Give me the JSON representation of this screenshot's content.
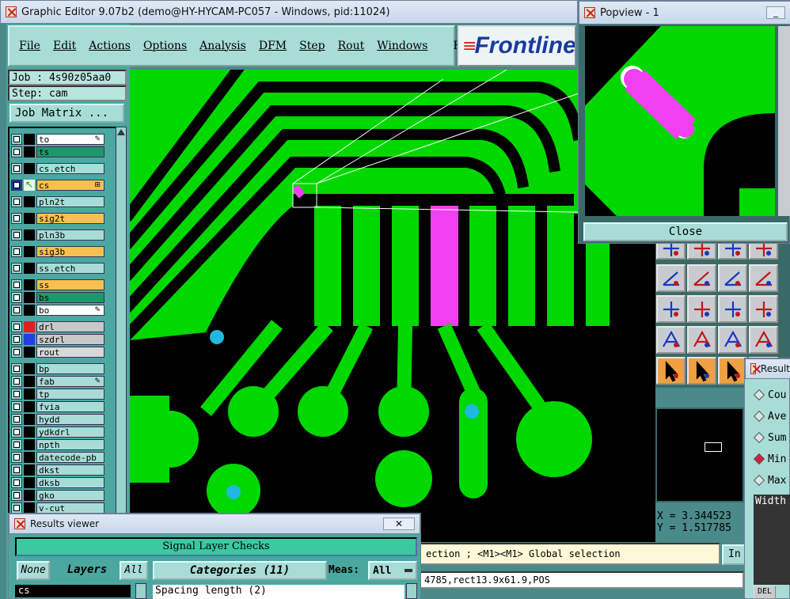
{
  "main_window": {
    "title": "Graphic Editor 9.07b2 (demo@HY-HYCAM-PC057 - Windows, pid:11024)"
  },
  "menu": [
    "File",
    "Edit",
    "Actions",
    "Options",
    "Analysis",
    "DFM",
    "Step",
    "Rout",
    "Windows",
    "Help"
  ],
  "logo_text": "Frontline",
  "job": {
    "label": "Job : 4s90z05aa0",
    "step": "Step: cam",
    "matrix_button": "Job Matrix ..."
  },
  "layers": [
    {
      "name": "to",
      "bg": "#ffffff",
      "swatch": "",
      "mark": "pen"
    },
    {
      "name": "ts",
      "bg": "#1a9a6a",
      "swatch": "",
      "mark": ""
    },
    {
      "name": "cs.etch",
      "bg": "#a8dcd6",
      "swatch": "",
      "mark": ""
    },
    {
      "name": "cs",
      "bg": "#f8c050",
      "swatch": "work",
      "mark": "grid"
    },
    {
      "name": "pln2t",
      "bg": "#a8dcd6",
      "swatch": "",
      "mark": ""
    },
    {
      "name": "sig2t",
      "bg": "#f8c050",
      "swatch": "",
      "mark": ""
    },
    {
      "name": "pln3b",
      "bg": "#a8dcd6",
      "swatch": "",
      "mark": ""
    },
    {
      "name": "sig3b",
      "bg": "#f8c050",
      "swatch": "",
      "mark": ""
    },
    {
      "name": "ss.etch",
      "bg": "#a8dcd6",
      "swatch": "",
      "mark": ""
    },
    {
      "name": "ss",
      "bg": "#f8c050",
      "swatch": "",
      "mark": ""
    },
    {
      "name": "bs",
      "bg": "#1a9a6a",
      "swatch": "",
      "mark": ""
    },
    {
      "name": "bo",
      "bg": "#ffffff",
      "swatch": "",
      "mark": "pen"
    },
    {
      "name": "drl",
      "bg": "#c8c8c8",
      "swatch": "#e02020",
      "mark": ""
    },
    {
      "name": "szdrl",
      "bg": "#c8c8c8",
      "swatch": "#2040e0",
      "mark": ""
    },
    {
      "name": "rout",
      "bg": "#d8d8d8",
      "swatch": "",
      "mark": ""
    },
    {
      "name": "bp",
      "bg": "#a8dcd6",
      "swatch": "",
      "mark": ""
    },
    {
      "name": "fab",
      "bg": "#a8dcd6",
      "swatch": "",
      "mark": "pen"
    },
    {
      "name": "tp",
      "bg": "#a8dcd6",
      "swatch": "",
      "mark": ""
    },
    {
      "name": "fvia",
      "bg": "#a8dcd6",
      "swatch": "",
      "mark": ""
    },
    {
      "name": "hydd",
      "bg": "#a8dcd6",
      "swatch": "",
      "mark": ""
    },
    {
      "name": "ydkdrl",
      "bg": "#a8dcd6",
      "swatch": "",
      "mark": ""
    },
    {
      "name": "npth",
      "bg": "#a8dcd6",
      "swatch": "",
      "mark": ""
    },
    {
      "name": "datecode-pb",
      "bg": "#a8dcd6",
      "swatch": "",
      "mark": ""
    },
    {
      "name": "dkst",
      "bg": "#a8dcd6",
      "swatch": "",
      "mark": ""
    },
    {
      "name": "dksb",
      "bg": "#a8dcd6",
      "swatch": "",
      "mark": ""
    },
    {
      "name": "gko",
      "bg": "#a8dcd6",
      "swatch": "",
      "mark": ""
    },
    {
      "name": "v-cut",
      "bg": "#a8dcd6",
      "swatch": "",
      "mark": ""
    }
  ],
  "popview": {
    "title": "Popview - 1",
    "close": "Close"
  },
  "coords": {
    "x": "X = 3.344523",
    "y": "Y = 1.517785"
  },
  "status": {
    "message": "ection ; <M1><M1> Global selection",
    "info": "4785,rect13.9x61.9,POS",
    "in_btn": "In"
  },
  "results_viewer": {
    "title": "Results viewer",
    "header": "Signal Layer Checks",
    "none": "None",
    "layers": "Layers",
    "all": "All",
    "categories": "Categories (11)",
    "meas_label": "Meas:",
    "meas_value": "All",
    "layer_value": "cs",
    "first_category": "Spacing length (2)"
  },
  "results_small": {
    "title": "Result",
    "options": [
      "Cou",
      "Ave",
      "Sum",
      "Min",
      "Max"
    ],
    "selected": "Min",
    "width_label": "Width",
    "del": "DEL"
  },
  "colors": {
    "copper": "#00d800",
    "board": "#000000",
    "highlight": "#f040f0",
    "pad_hole": "#20b8e0"
  }
}
